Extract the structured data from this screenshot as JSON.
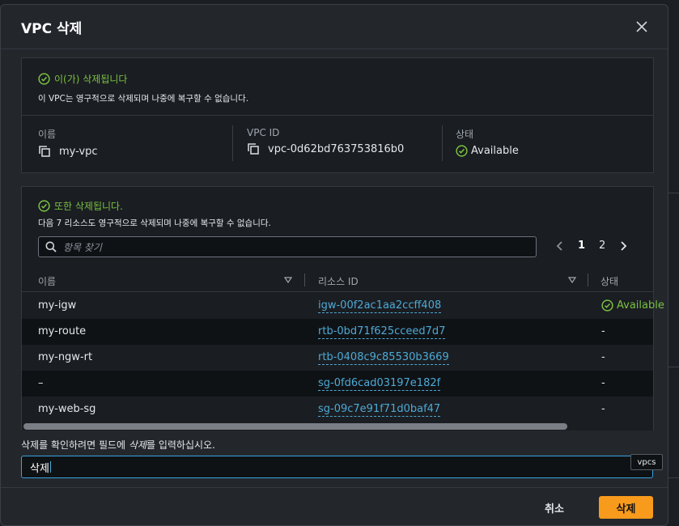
{
  "modal": {
    "title": "VPC 삭제"
  },
  "primary": {
    "status_title": "이(가) 삭제됩니다",
    "description": "이 VPC는 영구적으로 삭제되며 나중에 복구할 수 없습니다.",
    "fields": {
      "name_label": "이름",
      "name_value": "my-vpc",
      "id_label": "VPC ID",
      "id_value": "vpc-0d62bd763753816b0",
      "state_label": "상태",
      "state_value": "Available"
    }
  },
  "related": {
    "status_title": "또한 삭제됩니다.",
    "description": "다음 7 리소스도 영구적으로 삭제되며 나중에 복구할 수 없습니다.",
    "search_placeholder": "항목 찾기",
    "pages": [
      "1",
      "2"
    ],
    "current_page": "1",
    "columns": {
      "name": "이름",
      "resource_id": "리소스 ID",
      "state": "상태"
    },
    "rows": [
      {
        "name": "my-igw",
        "id": "igw-00f2ac1aa2ccff408",
        "state": "Available"
      },
      {
        "name": "my-route",
        "id": "rtb-0bd71f625cceed7d7",
        "state": "-"
      },
      {
        "name": "my-ngw-rt",
        "id": "rtb-0408c9c85530b3669",
        "state": "-"
      },
      {
        "name": "–",
        "id": "sg-0fd6cad03197e182f",
        "state": "-"
      },
      {
        "name": "my-web-sg",
        "id": "sg-09c7e91f71d0baf47",
        "state": "-"
      }
    ]
  },
  "confirm": {
    "label_prefix": "삭제를 확인하려면 필드에 ",
    "label_keyword": "삭제",
    "label_suffix": "를 입력하십시오.",
    "value": "삭제",
    "tooltip": "vpcs"
  },
  "footer": {
    "cancel_label": "취소",
    "delete_label": "삭제"
  },
  "colors": {
    "accent": "#f89a1c",
    "success": "#7ac142",
    "link": "#4ea9d6"
  }
}
